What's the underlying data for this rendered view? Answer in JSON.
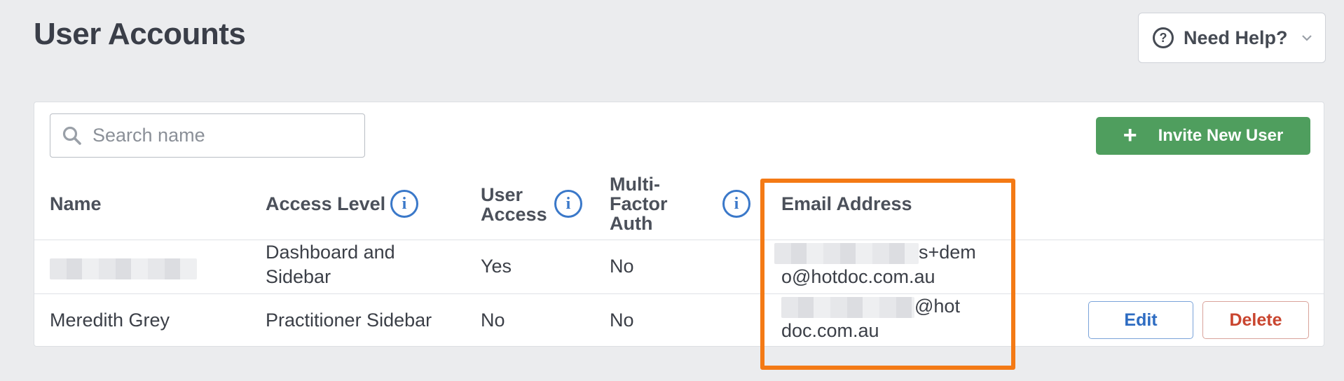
{
  "page": {
    "title": "User Accounts"
  },
  "help": {
    "label": "Need Help?",
    "icon": "question-circle-icon"
  },
  "search": {
    "placeholder": "Search name",
    "value": ""
  },
  "invite": {
    "label": "Invite New User",
    "icon": "plus-icon"
  },
  "table": {
    "columns": [
      "Name",
      "Access Level",
      "User Access",
      "Multi-Factor Auth",
      "Email Address"
    ],
    "column_lines": {
      "user_access": [
        "User",
        "Access"
      ],
      "mfa": [
        "Multi-",
        "Factor",
        "Auth"
      ]
    },
    "rows": [
      {
        "name": "",
        "access_level_lines": [
          "Dashboard and",
          "Sidebar"
        ],
        "user_access": "Yes",
        "mfa": "No",
        "email_lines": [
          "s+dem",
          "o@hotdoc.com.au"
        ]
      },
      {
        "name": "Meredith Grey",
        "access_level": "Practitioner Sidebar",
        "user_access": "No",
        "mfa": "No",
        "email_lines": [
          "@hot",
          "doc.com.au"
        ],
        "edit_label": "Edit",
        "delete_label": "Delete"
      }
    ]
  },
  "colors": {
    "accent_green": "#4f9e5e",
    "info_blue": "#3a78c9",
    "delete_red": "#c9452f",
    "highlight_orange": "#f47a15"
  }
}
